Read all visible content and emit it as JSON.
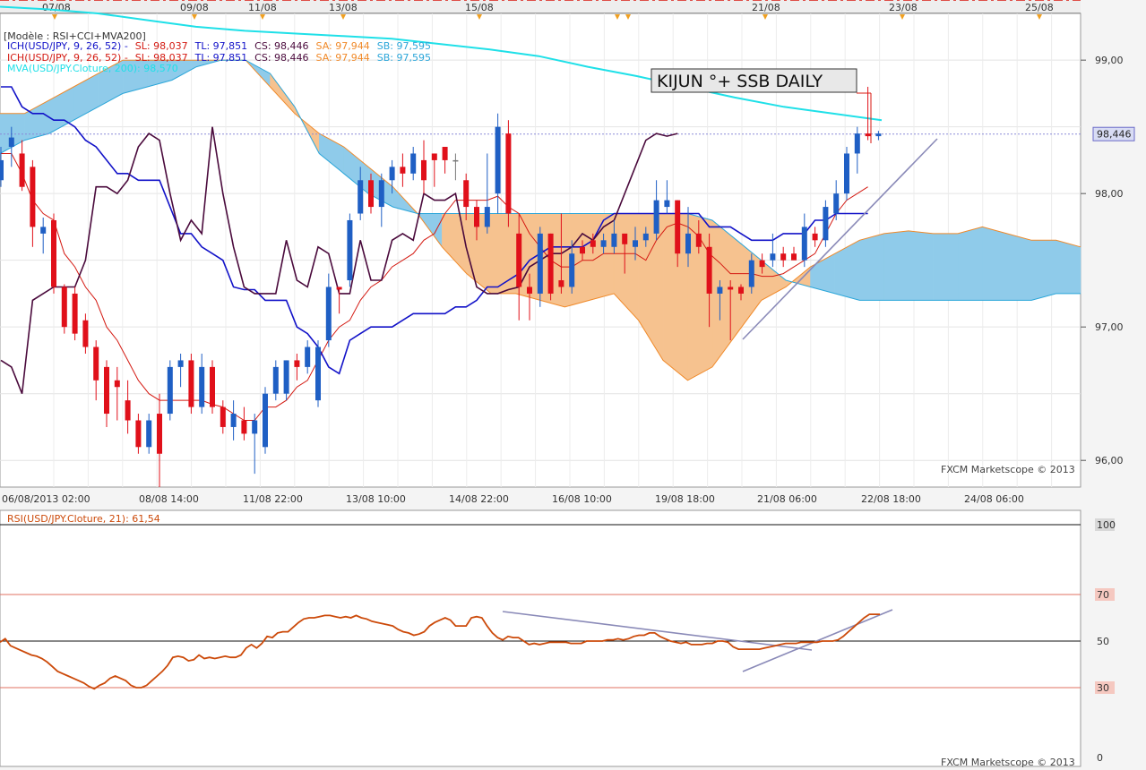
{
  "main": {
    "top_dates": [
      "07/08",
      "09/08",
      "11/08",
      "13/08",
      "15/08",
      "21/08",
      "23/08",
      "25/08"
    ],
    "bottom_dates": [
      "06/08/2013 02:00",
      "08/08 14:00",
      "11/08 22:00",
      "13/08 10:00",
      "14/08 22:00",
      "16/08 10:00",
      "19/08 18:00",
      "21/08 06:00",
      "22/08 18:00",
      "24/08 06:00"
    ],
    "y_ticks": [
      "99,00",
      "98,00",
      "97,00",
      "96,00"
    ],
    "y_tick_values": [
      99,
      98,
      97,
      96
    ],
    "price_tag": "98,446",
    "price_value": 98.446,
    "legend": {
      "model": "[Modèle : RSI+CCI+MVA200]",
      "ich1": {
        "name": "ICH(USD/JPY, 9, 26, 52) -",
        "sl": "SL: 98,037",
        "tl": "TL: 97,851",
        "cs": "CS: 98,446",
        "sa": "SA: 97,944",
        "sb": "SB: 97,595"
      },
      "ich2": {
        "name": "ICH(USD/JPY, 9, 26, 52) -",
        "sl": "SL: 98,037",
        "tl": "TL: 97,851",
        "cs": "CS: 98,446",
        "sa": "SA: 97,944",
        "sb": "SB: 97,595"
      },
      "mva": "MVA(USD/JPY.Cloture, 200): 98,570"
    },
    "annotation": "KIJUN °+ SSB DAILY",
    "resistance_level": 98.8,
    "watermark": "FXCM Marketscope © 2013"
  },
  "rsi": {
    "title": "RSI(USD/JPY.Cloture, 21): 61,54",
    "y_ticks": [
      "100",
      "70",
      "50",
      "30",
      "0"
    ],
    "y_tick_values": [
      100,
      70,
      50,
      30,
      0
    ],
    "watermark": "FXCM Marketscope © 2013"
  },
  "colors": {
    "bull": "#1f5fc4",
    "bear": "#e0101a",
    "neutral": "#787878",
    "kumo_bear": "#f6c28f",
    "kumo_bull": "#8fcbea",
    "tenkan": "#d41a12",
    "kijun": "#1212c8",
    "chikou": "#4a0a3c",
    "mva": "#1fe0e8",
    "ssa": "#f08a2a",
    "ssb": "#2ca6d9",
    "rsi": "#cc4a0a"
  },
  "chart_data": [
    {
      "type": "candlestick",
      "title": "USD/JPY",
      "ylim": [
        95.8,
        99.35
      ],
      "candles": [
        [
          98.1,
          98.35,
          98.05,
          98.25
        ],
        [
          98.35,
          98.5,
          98.2,
          98.42
        ],
        [
          98.3,
          98.4,
          98.02,
          98.05
        ],
        [
          98.2,
          98.25,
          97.6,
          97.75
        ],
        [
          97.7,
          97.82,
          97.55,
          97.75
        ],
        [
          97.8,
          97.85,
          97.25,
          97.3
        ],
        [
          97.3,
          97.32,
          96.95,
          97.0
        ],
        [
          97.25,
          97.3,
          96.9,
          96.95
        ],
        [
          97.05,
          97.1,
          96.8,
          96.85
        ],
        [
          96.85,
          96.9,
          96.45,
          96.6
        ],
        [
          96.7,
          96.75,
          96.25,
          96.35
        ],
        [
          96.6,
          96.7,
          96.3,
          96.55
        ],
        [
          96.45,
          96.6,
          96.2,
          96.3
        ],
        [
          96.3,
          96.35,
          96.05,
          96.1
        ],
        [
          96.1,
          96.35,
          96.05,
          96.3
        ],
        [
          96.35,
          96.5,
          95.8,
          96.05
        ],
        [
          96.35,
          96.75,
          96.3,
          96.7
        ],
        [
          96.7,
          96.8,
          96.55,
          96.75
        ],
        [
          96.75,
          96.8,
          96.35,
          96.4
        ],
        [
          96.4,
          96.8,
          96.35,
          96.7
        ],
        [
          96.7,
          96.75,
          96.35,
          96.4
        ],
        [
          96.4,
          96.45,
          96.2,
          96.25
        ],
        [
          96.25,
          96.45,
          96.15,
          96.35
        ],
        [
          96.3,
          96.4,
          96.15,
          96.2
        ],
        [
          96.2,
          96.35,
          95.9,
          96.3
        ],
        [
          96.1,
          96.55,
          96.05,
          96.5
        ],
        [
          96.5,
          96.75,
          96.45,
          96.7
        ],
        [
          96.5,
          96.75,
          96.45,
          96.75
        ],
        [
          96.75,
          96.8,
          96.6,
          96.7
        ],
        [
          96.7,
          96.9,
          96.65,
          96.85
        ],
        [
          96.45,
          96.9,
          96.4,
          96.85
        ],
        [
          96.9,
          97.4,
          96.85,
          97.3
        ],
        [
          97.3,
          97.3,
          97.1,
          97.28
        ],
        [
          97.35,
          97.85,
          97.3,
          97.8
        ],
        [
          97.85,
          98.2,
          97.8,
          98.1
        ],
        [
          98.1,
          98.15,
          97.85,
          97.9
        ],
        [
          97.9,
          98.15,
          97.75,
          98.1
        ],
        [
          98.1,
          98.25,
          98.0,
          98.2
        ],
        [
          98.2,
          98.3,
          98.05,
          98.15
        ],
        [
          98.15,
          98.35,
          98.1,
          98.3
        ],
        [
          98.25,
          98.4,
          98.0,
          98.1
        ],
        [
          98.3,
          98.3,
          98.05,
          98.25
        ],
        [
          98.35,
          98.35,
          98.15,
          98.25
        ],
        [
          98.25,
          98.3,
          98.1,
          98.25
        ],
        [
          98.1,
          98.15,
          97.8,
          97.9
        ],
        [
          97.9,
          97.95,
          97.65,
          97.75
        ],
        [
          97.75,
          98.3,
          97.7,
          97.9
        ],
        [
          98.0,
          98.6,
          97.85,
          98.5
        ],
        [
          98.45,
          98.55,
          97.75,
          97.85
        ],
        [
          97.7,
          97.85,
          97.05,
          97.3
        ],
        [
          97.3,
          97.4,
          97.05,
          97.25
        ],
        [
          97.25,
          97.75,
          97.15,
          97.7
        ],
        [
          97.7,
          97.7,
          97.2,
          97.25
        ],
        [
          97.35,
          97.85,
          97.25,
          97.3
        ],
        [
          97.3,
          97.65,
          97.25,
          97.55
        ],
        [
          97.6,
          97.65,
          97.5,
          97.55
        ],
        [
          97.65,
          97.7,
          97.55,
          97.6
        ],
        [
          97.6,
          97.7,
          97.55,
          97.65
        ],
        [
          97.6,
          97.8,
          97.55,
          97.7
        ],
        [
          97.7,
          97.65,
          97.4,
          97.62
        ],
        [
          97.6,
          97.75,
          97.5,
          97.65
        ],
        [
          97.65,
          97.75,
          97.6,
          97.7
        ],
        [
          97.7,
          98.1,
          97.65,
          97.95
        ],
        [
          97.9,
          98.1,
          97.85,
          97.95
        ],
        [
          97.95,
          97.95,
          97.45,
          97.55
        ],
        [
          97.55,
          97.9,
          97.45,
          97.7
        ],
        [
          97.7,
          97.8,
          97.55,
          97.6
        ],
        [
          97.6,
          97.7,
          97.0,
          97.25
        ],
        [
          97.25,
          97.35,
          97.05,
          97.3
        ],
        [
          97.3,
          97.35,
          96.9,
          97.28
        ],
        [
          97.3,
          97.32,
          97.2,
          97.25
        ],
        [
          97.3,
          97.55,
          97.25,
          97.5
        ],
        [
          97.5,
          97.55,
          97.4,
          97.45
        ],
        [
          97.5,
          97.7,
          97.45,
          97.55
        ],
        [
          97.55,
          97.6,
          97.45,
          97.5
        ],
        [
          97.55,
          97.6,
          97.5,
          97.5
        ],
        [
          97.5,
          97.85,
          97.45,
          97.75
        ],
        [
          97.7,
          97.75,
          97.6,
          97.65
        ],
        [
          97.65,
          97.95,
          97.6,
          97.9
        ],
        [
          97.85,
          98.1,
          97.8,
          98.0
        ],
        [
          98.0,
          98.35,
          97.95,
          98.3
        ],
        [
          98.3,
          98.5,
          98.15,
          98.45
        ],
        [
          98.45,
          98.8,
          98.4,
          98.43
        ],
        [
          98.43,
          98.47,
          98.4,
          98.45
        ]
      ],
      "lines": {
        "tenkan": [
          98.3,
          98.3,
          98.15,
          97.95,
          97.85,
          97.8,
          97.55,
          97.45,
          97.3,
          97.2,
          97.0,
          96.9,
          96.75,
          96.6,
          96.5,
          96.45,
          96.45,
          96.45,
          96.45,
          96.45,
          96.42,
          96.4,
          96.35,
          96.3,
          96.3,
          96.4,
          96.4,
          96.45,
          96.55,
          96.6,
          96.75,
          96.9,
          97.0,
          97.05,
          97.2,
          97.3,
          97.35,
          97.45,
          97.5,
          97.55,
          97.65,
          97.7,
          97.85,
          97.95,
          97.95,
          97.95,
          97.95,
          97.98,
          97.9,
          97.85,
          97.7,
          97.6,
          97.5,
          97.45,
          97.45,
          97.5,
          97.5,
          97.55,
          97.55,
          97.55,
          97.55,
          97.5,
          97.65,
          97.75,
          97.78,
          97.75,
          97.68,
          97.55,
          97.48,
          97.4,
          97.4,
          97.4,
          97.38,
          97.38,
          97.4,
          97.45,
          97.5,
          97.55,
          97.7,
          97.85,
          97.95,
          98.0,
          98.05
        ],
        "kijun": [
          98.8,
          98.8,
          98.65,
          98.6,
          98.6,
          98.55,
          98.55,
          98.5,
          98.4,
          98.35,
          98.25,
          98.15,
          98.15,
          98.1,
          98.1,
          98.1,
          97.9,
          97.7,
          97.7,
          97.6,
          97.55,
          97.5,
          97.3,
          97.28,
          97.28,
          97.2,
          97.2,
          97.2,
          97.0,
          96.95,
          96.85,
          96.7,
          96.65,
          96.9,
          96.95,
          97.0,
          97.0,
          97.0,
          97.05,
          97.1,
          97.1,
          97.1,
          97.1,
          97.15,
          97.15,
          97.2,
          97.3,
          97.3,
          97.35,
          97.4,
          97.5,
          97.55,
          97.6,
          97.6,
          97.6,
          97.6,
          97.65,
          97.8,
          97.85,
          97.85,
          97.85,
          97.85,
          97.85,
          97.85,
          97.85,
          97.85,
          97.85,
          97.75,
          97.75,
          97.75,
          97.7,
          97.65,
          97.65,
          97.65,
          97.7,
          97.7,
          97.7,
          97.8,
          97.8,
          97.85,
          97.85,
          97.85,
          97.85
        ],
        "chikou": [
          96.75,
          96.7,
          96.5,
          97.2,
          97.25,
          97.3,
          97.3,
          97.3,
          97.5,
          98.05,
          98.05,
          98.0,
          98.1,
          98.35,
          98.45,
          98.4,
          98.0,
          97.65,
          97.8,
          97.7,
          98.5,
          98.0,
          97.6,
          97.3,
          97.25,
          97.25,
          97.25,
          97.65,
          97.35,
          97.3,
          97.6,
          97.55,
          97.25,
          97.25,
          97.65,
          97.35,
          97.35,
          97.65,
          97.7,
          97.65,
          98.0,
          97.95,
          97.95,
          98.0,
          97.6,
          97.3,
          97.25,
          97.25,
          97.28,
          97.3,
          97.45,
          97.5,
          97.55,
          97.55,
          97.6,
          97.7,
          97.65,
          97.75,
          97.8,
          98.0,
          98.2,
          98.4,
          98.45,
          98.43,
          98.45
        ],
        "mva": [
          99.4,
          99.38,
          99.35,
          99.3,
          99.25,
          99.22,
          99.2,
          99.18,
          99.16,
          99.12,
          99.08,
          99.03,
          98.95,
          98.88,
          98.8,
          98.72,
          98.65,
          98.6,
          98.55
        ]
      },
      "kumo": {
        "ssa": [
          98.6,
          98.6,
          98.7,
          98.8,
          98.9,
          99.0,
          99.0,
          99.0,
          99.0,
          99.0,
          99.0,
          98.8,
          98.6,
          98.45,
          98.35,
          98.2,
          98.05,
          97.85,
          97.6,
          97.4,
          97.25,
          97.25,
          97.2,
          97.15,
          97.2,
          97.25,
          97.05,
          96.75,
          96.6,
          96.7,
          96.95,
          97.2,
          97.3,
          97.45,
          97.55,
          97.65,
          97.7,
          97.72,
          97.7,
          97.7,
          97.75,
          97.7,
          97.65,
          97.65,
          97.6
        ],
        "ssb": [
          98.3,
          98.4,
          98.45,
          98.55,
          98.65,
          98.75,
          98.8,
          98.85,
          98.95,
          99.0,
          99.0,
          98.9,
          98.65,
          98.3,
          98.15,
          98.0,
          97.9,
          97.85,
          97.85,
          97.85,
          97.85,
          97.85,
          97.85,
          97.85,
          97.85,
          97.85,
          97.85,
          97.85,
          97.85,
          97.8,
          97.65,
          97.5,
          97.35,
          97.3,
          97.25,
          97.2,
          97.2,
          97.2,
          97.2,
          97.2,
          97.2,
          97.2,
          97.2,
          97.25,
          97.25
        ]
      }
    },
    {
      "type": "line",
      "title": "RSI(USD/JPY.Cloture, 21): 61,54",
      "ylim": [
        0,
        100
      ],
      "values": [
        49.5,
        51,
        48,
        47,
        46,
        45,
        44,
        43.5,
        42.5,
        41,
        39,
        37,
        36,
        35,
        34,
        33,
        32,
        30.5,
        29.5,
        31,
        32,
        34,
        35,
        34,
        33,
        31,
        30,
        30,
        31,
        33,
        35,
        37,
        39.5,
        43,
        43.5,
        43,
        41.5,
        42,
        44,
        42.5,
        43,
        42.5,
        43,
        43.5,
        43,
        43,
        44,
        47,
        48.5,
        47,
        49,
        52,
        51.5,
        53.5,
        54,
        54,
        56,
        58,
        59.5,
        60,
        60,
        60.5,
        61,
        61,
        60.5,
        60,
        60.5,
        60,
        61,
        60,
        59.5,
        58.5,
        58,
        57.5,
        57,
        56.5,
        55,
        54,
        53.5,
        52.5,
        53,
        54,
        56.5,
        58,
        59,
        60,
        59,
        56.5,
        56.5,
        56.5,
        60,
        60.5,
        60,
        56.5,
        53.5,
        51.5,
        50.5,
        52,
        51.5,
        51.5,
        50,
        48.5,
        49,
        48.5,
        49,
        49.5,
        49.5,
        49.5,
        49.5,
        49,
        49,
        49,
        50,
        50,
        50,
        50,
        50.5,
        50.5,
        51,
        50.5,
        51,
        52,
        52.5,
        52.5,
        53.5,
        53.5,
        52,
        51,
        50,
        49.5,
        49,
        49.5,
        48.5,
        48.5,
        48.5,
        49,
        49,
        50,
        50,
        49.5,
        47.5,
        46.5,
        46.5,
        46.5,
        46.5,
        46.5,
        47,
        47.5,
        48,
        48.5,
        49,
        49,
        49,
        49.5,
        49.5,
        49.5,
        49.5,
        50,
        50,
        50,
        50.5,
        52,
        54,
        56,
        58,
        60,
        61.5,
        61.5,
        61.5
      ]
    }
  ]
}
